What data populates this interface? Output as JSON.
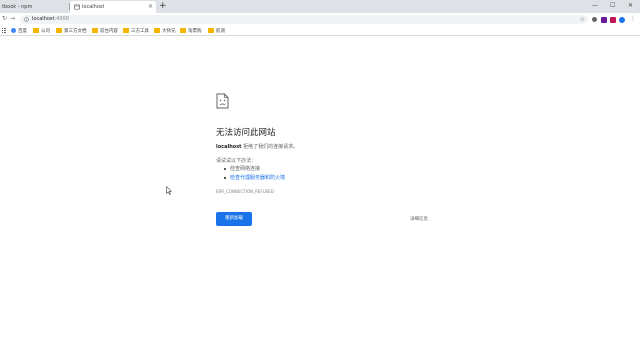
{
  "browser": {
    "tabs": [
      {
        "title": "tbook - npm",
        "active": false
      },
      {
        "title": "localhost",
        "active": true
      }
    ],
    "new_tab_symbol": "+",
    "window_controls": [
      "—",
      "☐",
      "✕"
    ],
    "nav": {
      "back": "←",
      "forward": "→",
      "reload": "↻"
    },
    "address": {
      "host": "localhost",
      "port": ":4000"
    },
    "bookmark_star": "☆",
    "bookmarks": [
      "百度",
      "公司",
      "第三方文档",
      "前台内容",
      "三方工具",
      "大师兄",
      "淘票购",
      "航测"
    ]
  },
  "error_page": {
    "title": "无法访问此网站",
    "host": "localhost",
    "message": " 拒绝了我们的连接请求。",
    "try_label": "请试试以下办法：",
    "suggestions": [
      "检查网络连接",
      "检查代理服务器和防火墙"
    ],
    "error_code": "ERR_CONNECTION_REFUSED",
    "reload_button": "重新加载",
    "details_button": "详细信息"
  },
  "colors": {
    "accent": "#1a73e8",
    "tabstrip": "#dee1e6",
    "omnibox": "#f1f3f4",
    "folder": "#f4b400"
  },
  "icons": [
    "sad-page-icon",
    "info-icon",
    "star-icon",
    "folder-icon",
    "apps-icon",
    "mouse-cursor-icon"
  ]
}
